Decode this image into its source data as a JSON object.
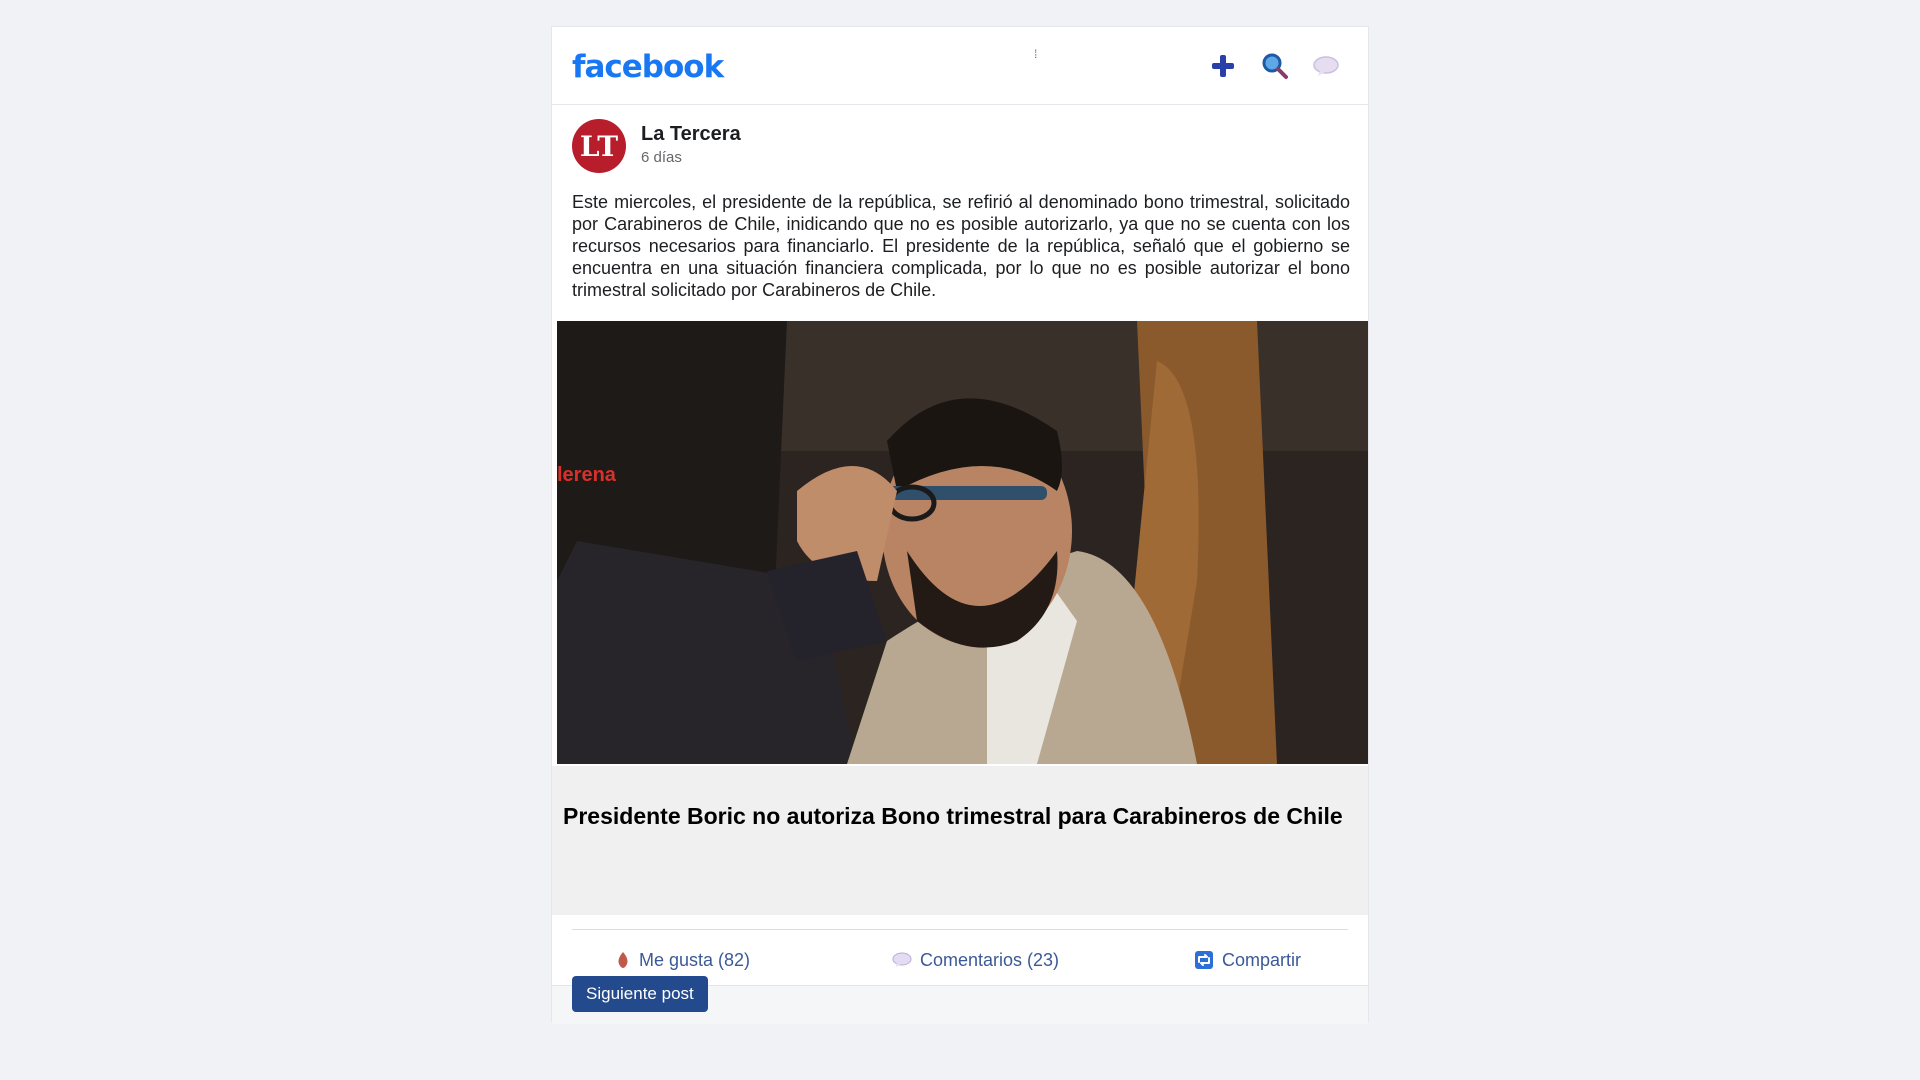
{
  "header": {
    "logo_text": "facebook",
    "icons": [
      "plus-icon",
      "search-icon",
      "chat-bubble-icon"
    ]
  },
  "post": {
    "avatar_initials": "LT",
    "page_name": "La Tercera",
    "time": "6 días",
    "text": "Este miercoles, el presidente de la república, se refirió al denominado bono trimestral, solicitado por Carabineros de Chile, inidicando que no es posible autorizarlo, ya que no se cuenta con los recursos necesarios para financiarlo. El presidente de la república, señaló que el gobierno se encuentra en una situación financiera complicada, por lo que no es posible autorizar el bono trimestral solicitado por Carabineros de Chile.",
    "image_overlay_text": "lerena",
    "link_title": "Presidente Boric no autoriza Bono trimestral para Carabineros de Chile"
  },
  "actions": {
    "like": "Me gusta (82)",
    "comment": "Comentarios (23)",
    "share": "Compartir"
  },
  "next_button": "Siguiente post",
  "colors": {
    "brand": "#1877f2",
    "action_text": "#3b5998",
    "button_bg": "#234a8d",
    "avatar_bg": "#b81d2c"
  }
}
